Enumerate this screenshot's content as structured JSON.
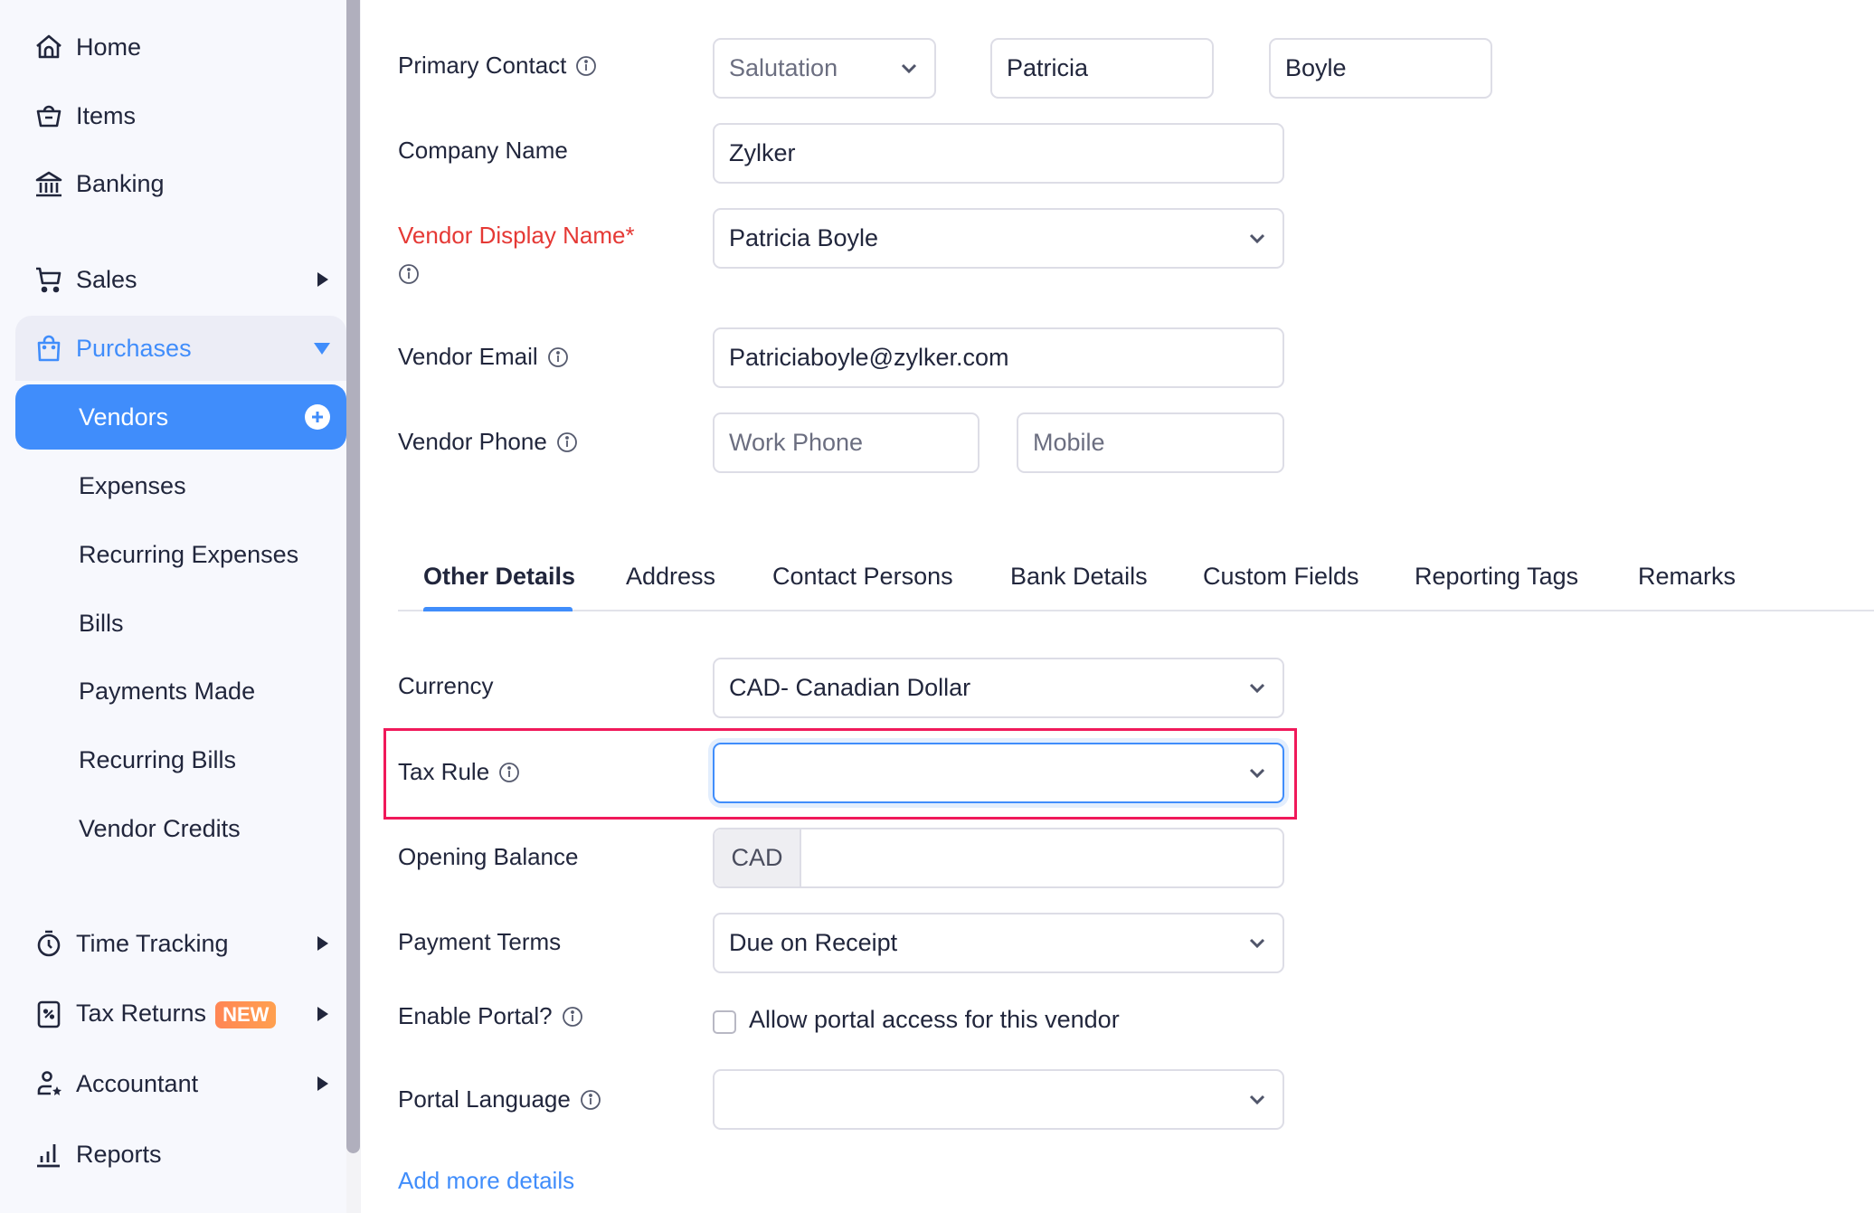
{
  "sidebar": {
    "items": [
      {
        "label": "Home",
        "icon": "home-icon"
      },
      {
        "label": "Items",
        "icon": "basket-icon"
      },
      {
        "label": "Banking",
        "icon": "bank-icon"
      },
      {
        "label": "Sales",
        "icon": "cart-icon"
      },
      {
        "label": "Purchases",
        "icon": "shopping-bag-icon"
      },
      {
        "label": "Time Tracking",
        "icon": "stopwatch-icon"
      },
      {
        "label": "Tax Returns",
        "icon": "tax-percent-icon",
        "badge": "NEW"
      },
      {
        "label": "Accountant",
        "icon": "accountant-icon"
      },
      {
        "label": "Reports",
        "icon": "bar-chart-icon"
      }
    ],
    "purchases_sub": [
      {
        "label": "Vendors",
        "active": true
      },
      {
        "label": "Expenses"
      },
      {
        "label": "Recurring Expenses"
      },
      {
        "label": "Bills"
      },
      {
        "label": "Payments Made"
      },
      {
        "label": "Recurring Bills"
      },
      {
        "label": "Vendor Credits"
      }
    ]
  },
  "form": {
    "primary_contact": {
      "label": "Primary Contact",
      "salutation_placeholder": "Salutation",
      "first_name": "Patricia",
      "last_name": "Boyle"
    },
    "company_name": {
      "label": "Company Name",
      "value": "Zylker"
    },
    "display_name": {
      "label": "Vendor Display Name*",
      "value": "Patricia Boyle"
    },
    "email": {
      "label": "Vendor Email",
      "value": "Patriciaboyle@zylker.com"
    },
    "phone": {
      "label": "Vendor Phone",
      "work_placeholder": "Work Phone",
      "mobile_placeholder": "Mobile"
    }
  },
  "tabs": [
    "Other Details",
    "Address",
    "Contact Persons",
    "Bank Details",
    "Custom Fields",
    "Reporting Tags",
    "Remarks"
  ],
  "other_details": {
    "currency": {
      "label": "Currency",
      "value": "CAD- Canadian Dollar"
    },
    "tax_rule": {
      "label": "Tax Rule",
      "value": ""
    },
    "opening_balance": {
      "label": "Opening Balance",
      "prefix": "CAD",
      "value": ""
    },
    "payment_terms": {
      "label": "Payment Terms",
      "value": "Due on Receipt"
    },
    "enable_portal": {
      "label": "Enable Portal?",
      "checkbox_label": "Allow portal access for this vendor",
      "checked": false
    },
    "portal_language": {
      "label": "Portal Language",
      "value": ""
    },
    "add_more": "Add more details"
  },
  "colors": {
    "accent": "#408dfb",
    "required": "#e53935",
    "highlight": "#f0195a",
    "badge": "#ff8654"
  }
}
